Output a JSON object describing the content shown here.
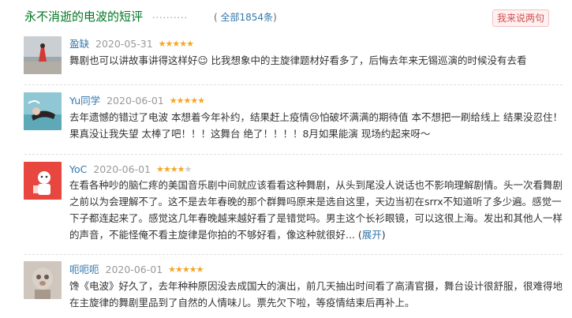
{
  "header": {
    "title": "永不消逝的电波的短评",
    "dots": "··········",
    "count_prefix": "(",
    "count_link": "全部1854条",
    "count_suffix": ")",
    "write_button": "我来说两句"
  },
  "comments": [
    {
      "user": "盈缺",
      "date": "2020-05-31",
      "rating": 5,
      "text": "舞剧也可以讲故事讲得这样好😉 比我想象中的主旋律题材好看多了，后悔去年来无锡巡演的时候没有去看",
      "expand_prefix": "",
      "expand_link": "",
      "expand_suffix": ""
    },
    {
      "user": "Yu同学",
      "date": "2020-06-01",
      "rating": 5,
      "text": "去年遗憾的错过了电波 本想着今年补约，结果赶上疫情😢怕破坏满满的期待值 本不想把一刷给线上 结果没忍住！果真没让我失望 太棒了吧！！！这舞台 绝了！！！！8月如果能演 现场约起来呀～",
      "expand_prefix": "",
      "expand_link": "",
      "expand_suffix": ""
    },
    {
      "user": "YoC",
      "date": "2020-06-01",
      "rating": 4,
      "text": "在看各种吵的脑仁疼的美国音乐剧中间就应该看看这种舞剧，从头到尾没人说话也不影响理解剧情。头一次看舞剧之前以为会理解不了。这不是去年春晚的那个群舞吗原来是选自这里，天边当初在srrx不知道听了多少遍。感觉一下子都连起来了。感觉这几年春晚越来越好看了是错觉吗。男主这个长衫眼镜，可以这很上海。发出和其他人一样的声音，不能怪俺不看主旋律是你拍的不够好看，像这种就很好...",
      "expand_prefix": " (",
      "expand_link": "展开",
      "expand_suffix": ")"
    },
    {
      "user": "呃呃呃",
      "date": "2020-06-01",
      "rating": 5,
      "text": "馋《电波》好久了，去年种种原因没去成国大的演出，前几天抽出时间看了高清官摄，舞台设计很舒服，很难得地在主旋律的舞剧里品到了自然的人情味儿。票先欠下啦，等疫情结束后再补上。",
      "expand_prefix": "",
      "expand_link": "",
      "expand_suffix": ""
    }
  ],
  "colors": {
    "title_green": "#007722",
    "link_blue": "#3377aa",
    "star_on": "#f5a623",
    "star_off": "#cccccc",
    "button_bg": "#fff1f1",
    "button_text": "#d05050"
  }
}
